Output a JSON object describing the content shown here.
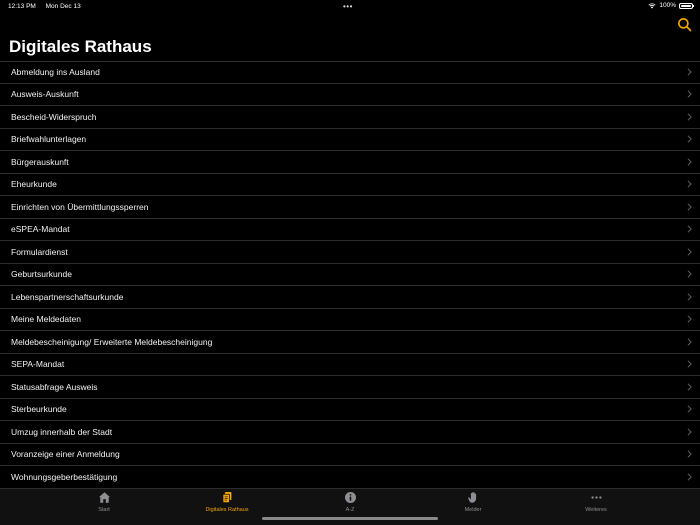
{
  "status_bar": {
    "time": "12:13 PM",
    "date": "Mon Dec 13",
    "dots": "•••",
    "battery": "100%"
  },
  "header": {
    "title": "Digitales Rathaus"
  },
  "colors": {
    "accent": "#f0a500",
    "background": "#000000",
    "separator": "#2c2c2e",
    "inactive": "#8e8e93"
  },
  "list": {
    "items": [
      {
        "label": "Abmeldung ins Ausland"
      },
      {
        "label": "Ausweis-Auskunft"
      },
      {
        "label": "Bescheid-Widerspruch"
      },
      {
        "label": "Briefwahlunterlagen"
      },
      {
        "label": "Bürgerauskunft"
      },
      {
        "label": "Eheurkunde"
      },
      {
        "label": "Einrichten von Übermittlungssperren"
      },
      {
        "label": "eSPEA-Mandat"
      },
      {
        "label": "Formulardienst"
      },
      {
        "label": "Geburtsurkunde"
      },
      {
        "label": "Lebenspartnerschaftsurkunde"
      },
      {
        "label": "Meine Meldedaten"
      },
      {
        "label": "Meldebescheinigung/ Erweiterte Meldebescheinigung"
      },
      {
        "label": "SEPA-Mandat"
      },
      {
        "label": "Statusabfrage Ausweis"
      },
      {
        "label": "Sterbeurkunde"
      },
      {
        "label": "Umzug innerhalb der Stadt"
      },
      {
        "label": "Voranzeige einer Anmeldung"
      },
      {
        "label": "Wohnungsgeberbestätigung"
      }
    ]
  },
  "tabs": [
    {
      "label": "Start",
      "icon": "house-icon",
      "active": false
    },
    {
      "label": "Digitales Rathaus",
      "icon": "documents-icon",
      "active": true
    },
    {
      "label": "A-Z",
      "icon": "info-icon",
      "active": false
    },
    {
      "label": "Melder",
      "icon": "hand-icon",
      "active": false
    },
    {
      "label": "Weiteres",
      "icon": "more-icon",
      "active": false
    }
  ]
}
